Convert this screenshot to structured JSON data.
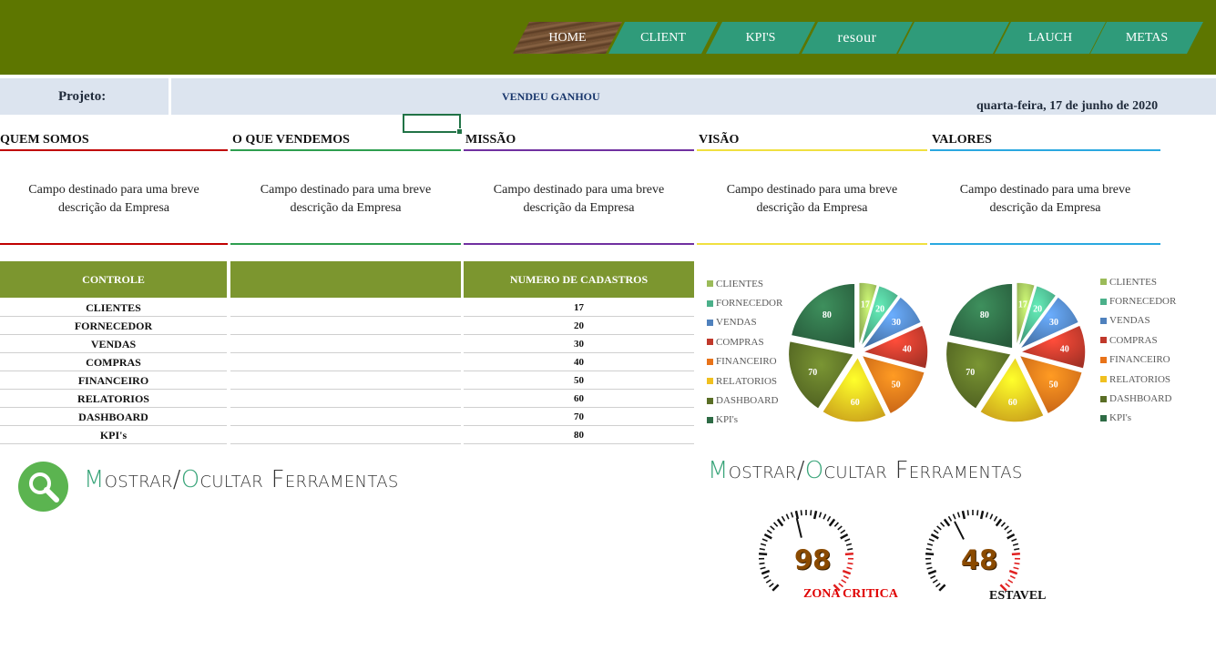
{
  "nav": {
    "tabs": [
      {
        "label": "HOME"
      },
      {
        "label": "CLIENT"
      },
      {
        "label": "KPI'S"
      },
      {
        "label": "resour"
      },
      {
        "label": ""
      },
      {
        "label": "LAUCH"
      },
      {
        "label": "METAS"
      }
    ]
  },
  "project": {
    "label": "Projeto:",
    "name": "VENDEU GANHOU",
    "date": "quarta-feira, 17 de junho de 2020"
  },
  "sections": [
    {
      "title": "QUEM SOMOS",
      "desc1": "Campo destinado para uma breve",
      "desc2": "descrição da Empresa",
      "color": "#c00000"
    },
    {
      "title": "O QUE VENDEMOS",
      "desc1": "Campo destinado para uma breve",
      "desc2": "descrição da Empresa",
      "color": "#2e9e4f"
    },
    {
      "title": "MISSÃO",
      "desc1": "Campo destinado para uma breve",
      "desc2": "descrição da Empresa",
      "color": "#7030a0"
    },
    {
      "title": "VISÃO",
      "desc1": "Campo destinado para uma breve",
      "desc2": "descrição da Empresa",
      "color": "#f0e040"
    },
    {
      "title": "VALORES",
      "desc1": "Campo destinado para uma breve",
      "desc2": "descrição da Empresa",
      "color": "#2aa8e0"
    }
  ],
  "table": {
    "header_left": "CONTROLE",
    "header_middle": "",
    "header_right": "NUMERO DE CADASTROS",
    "rows": [
      {
        "name": "CLIENTES",
        "value": "17"
      },
      {
        "name": "FORNECEDOR",
        "value": "20"
      },
      {
        "name": "VENDAS",
        "value": "30"
      },
      {
        "name": "COMPRAS",
        "value": "40"
      },
      {
        "name": "FINANCEIRO",
        "value": "50"
      },
      {
        "name": "RELATORIOS",
        "value": "60"
      },
      {
        "name": "DASHBOARD",
        "value": "70"
      },
      {
        "name": "KPI's",
        "value": "80"
      }
    ]
  },
  "chart_data": [
    {
      "type": "pie",
      "categories": [
        "CLIENTES",
        "FORNECEDOR",
        "VENDAS",
        "COMPRAS",
        "FINANCEIRO",
        "RELATORIOS",
        "DASHBOARD",
        "KPI's"
      ],
      "values": [
        17,
        20,
        30,
        40,
        50,
        60,
        70,
        80
      ],
      "colors": [
        "#9bbb59",
        "#4bb08a",
        "#4f81bd",
        "#c0392b",
        "#e8731a",
        "#f0c020",
        "#5a6e26",
        "#2e6b45"
      ],
      "legend": "left",
      "exploded": true
    },
    {
      "type": "pie",
      "categories": [
        "CLIENTES",
        "FORNECEDOR",
        "VENDAS",
        "COMPRAS",
        "FINANCEIRO",
        "RELATORIOS",
        "DASHBOARD",
        "KPI's"
      ],
      "values": [
        17,
        20,
        30,
        40,
        50,
        60,
        70,
        80
      ],
      "colors": [
        "#9bbb59",
        "#4bb08a",
        "#4f81bd",
        "#c0392b",
        "#e8731a",
        "#f0c020",
        "#5a6e26",
        "#2e6b45"
      ],
      "legend": "right",
      "exploded": true
    }
  ],
  "toggles": {
    "left": {
      "c1": "M",
      "r1": "ostrar/",
      "c2": "O",
      "r2": "cultar Ferramentas"
    },
    "right": {
      "c1": "M",
      "r1": "ostrar/",
      "c2": "O",
      "r2": "cultar Ferramentas"
    }
  },
  "gauges": [
    {
      "value": "98",
      "label": "ZONA CRITICA",
      "label_color": "#e00000",
      "level": 0.98
    },
    {
      "value": "48",
      "label": "ESTAVEL",
      "label_color": "#111111",
      "level": 0.48
    }
  ],
  "icons": {
    "search": "search-icon",
    "gauge": "gauge-icon"
  }
}
